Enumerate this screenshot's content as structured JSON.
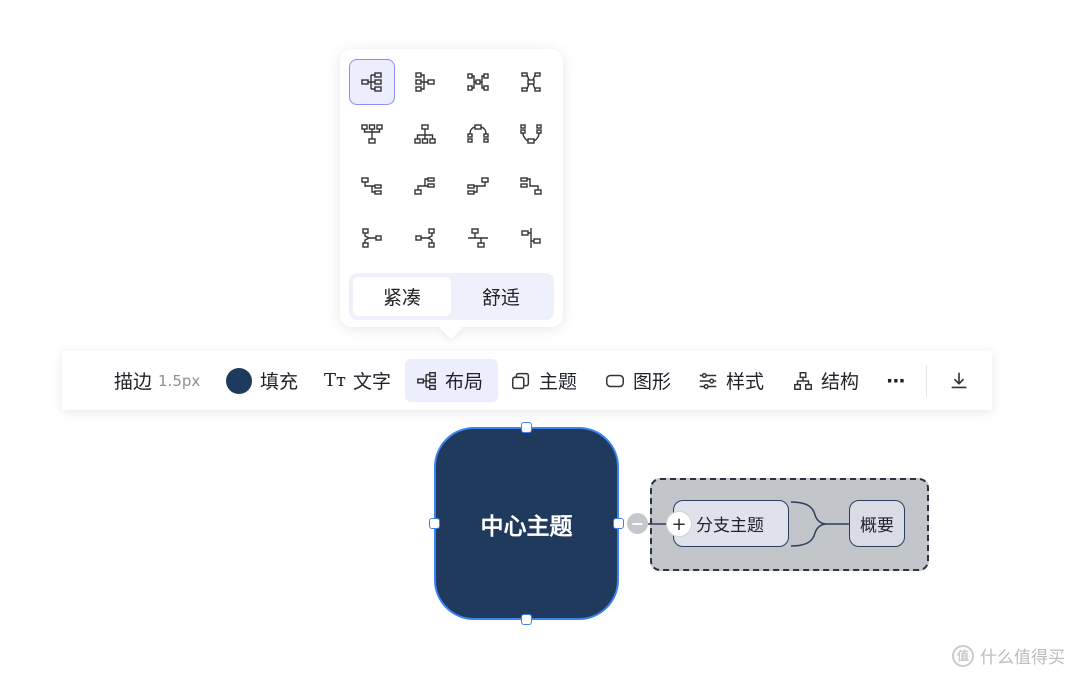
{
  "layout_popover": {
    "options": [
      {
        "name": "logic-right"
      },
      {
        "name": "logic-both"
      },
      {
        "name": "mindmap-both"
      },
      {
        "name": "mindmap-tree"
      },
      {
        "name": "org-up"
      },
      {
        "name": "org-down"
      },
      {
        "name": "tree-arc"
      },
      {
        "name": "tree-down"
      },
      {
        "name": "stair-right-down"
      },
      {
        "name": "stair-right-up"
      },
      {
        "name": "stair-left-up"
      },
      {
        "name": "stair-left-down"
      },
      {
        "name": "fish-right"
      },
      {
        "name": "fish-left"
      },
      {
        "name": "timeline-h"
      },
      {
        "name": "timeline-v"
      }
    ],
    "selected_index": 0,
    "spacing": {
      "compact": "紧凑",
      "comfortable": "舒适",
      "active": "compact"
    }
  },
  "toolbar": {
    "stroke_label": "描边",
    "stroke_width": "1.5px",
    "fill_label": "填充",
    "fill_color": "#1e3a5f",
    "text_icon": "Tт",
    "text_label": "文字",
    "layout_label": "布局",
    "topic_label": "主题",
    "shape_label": "图形",
    "style_label": "样式",
    "structure_label": "结构",
    "more_label": "···"
  },
  "canvas": {
    "central_topic": "中心主题",
    "branch_topic": "分支主题",
    "summary_topic": "概要",
    "collapse_symbol": "−",
    "expand_symbol": "+"
  },
  "watermark": {
    "logo": "值",
    "text": "什么值得买"
  }
}
